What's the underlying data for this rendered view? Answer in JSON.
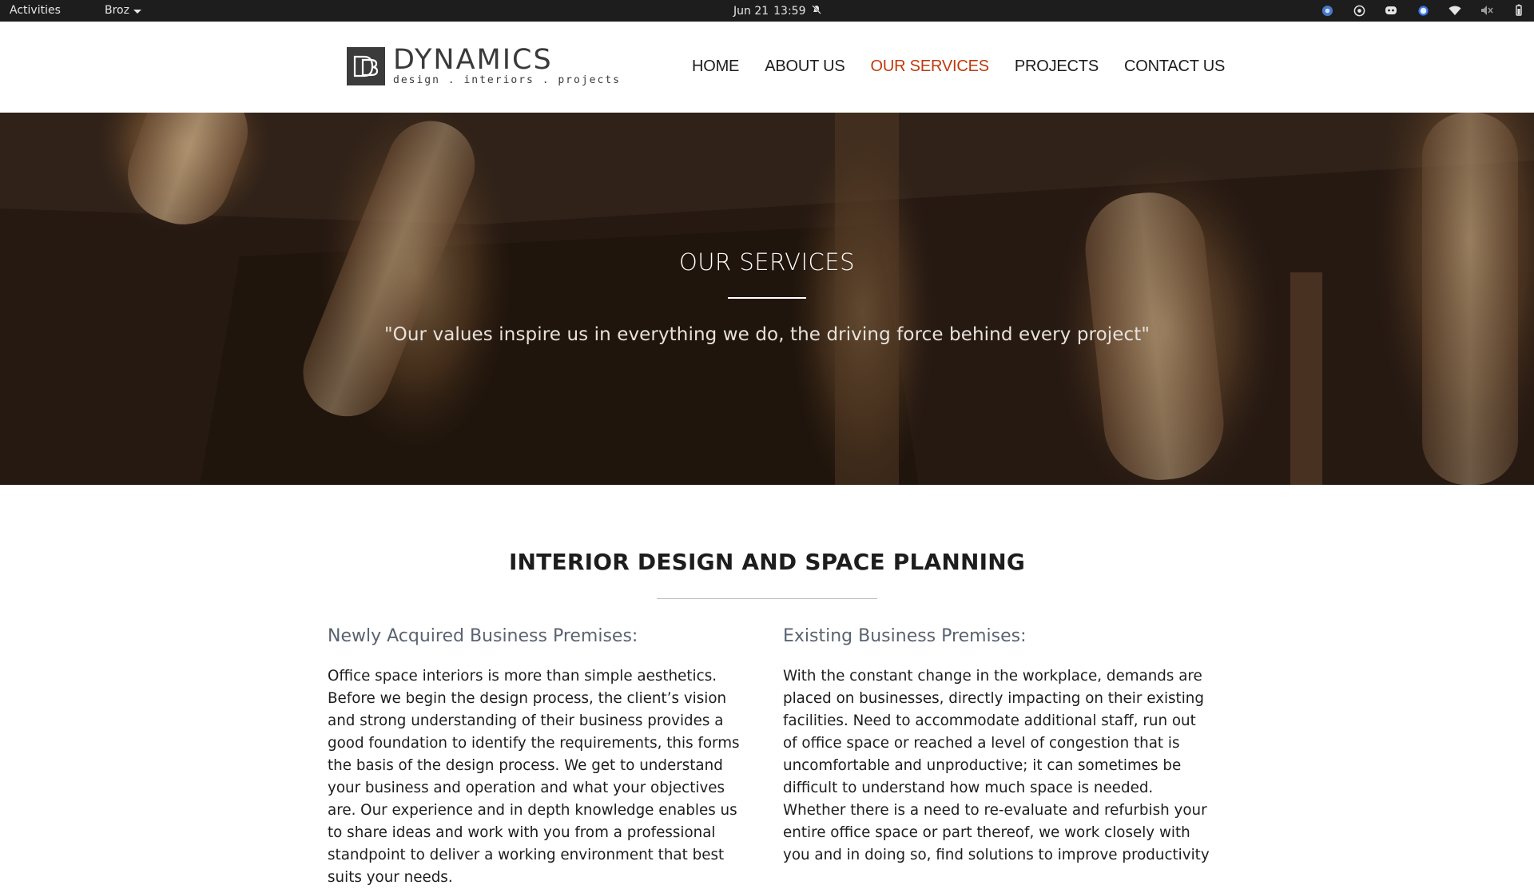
{
  "system_bar": {
    "activities": "Activities",
    "app_name": "Broz",
    "date": "Jun 21",
    "time": "13:59",
    "tray_icons": [
      "chrome-icon",
      "obs-icon",
      "discord-icon",
      "signal-icon",
      "wifi-icon",
      "volume-muted-icon",
      "battery-icon"
    ]
  },
  "site": {
    "logo": {
      "brand": "DYNAMICS",
      "tagline": "design . interiors . projects"
    },
    "nav": [
      {
        "label": "HOME",
        "active": false
      },
      {
        "label": "ABOUT US",
        "active": false
      },
      {
        "label": "OUR SERVICES",
        "active": true
      },
      {
        "label": "PROJECTS",
        "active": false
      },
      {
        "label": "CONTACT US",
        "active": false
      }
    ],
    "accent_color": "#c0390b"
  },
  "hero": {
    "title": "OUR SERVICES",
    "quote": "\"Our values inspire us in everything we do, the driving force behind every project\""
  },
  "section": {
    "title": "INTERIOR DESIGN AND SPACE PLANNING",
    "columns": [
      {
        "heading": "Newly Acquired Business Premises:",
        "body": "Office space interiors is more than simple aesthetics. Before we begin the design process, the client’s vision and strong understanding of their business provides a good foundation to identify the requirements, this forms the basis of the design process. We get to understand your business and operation and what your objectives are. Our experience and in depth knowledge enables us to share ideas and work with you from a professional standpoint to deliver a working environment that best suits your needs."
      },
      {
        "heading": "Existing Business Premises:",
        "body": "With the constant change in the workplace, demands are placed on businesses, directly impacting on their existing facilities. Need to accommodate additional staff, run out of office space or reached a level of congestion that is uncomfortable and unproductive; it can sometimes be difficult to understand how much space is needed. Whether there is a need to re-evaluate and refurbish your entire office space or part thereof, we work closely with you and in doing so, find solutions to improve productivity"
      }
    ]
  }
}
